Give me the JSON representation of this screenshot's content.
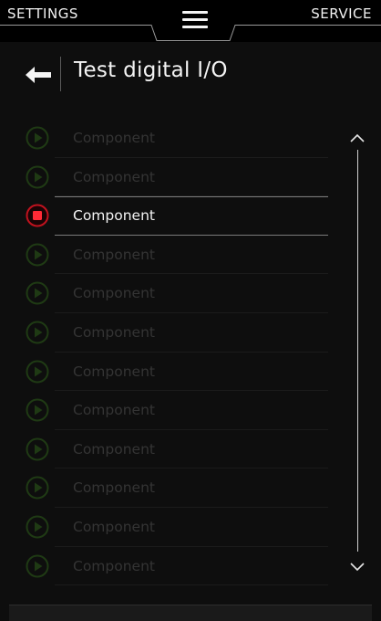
{
  "topbar": {
    "left_tab": "SETTINGS",
    "right_tab": "SERVICE",
    "menu_icon": "hamburger-icon"
  },
  "header": {
    "back_icon": "arrow-left-icon",
    "title": "Test digital I/O"
  },
  "list": {
    "items": [
      {
        "label": "Component",
        "state": "inactive",
        "icon": "play-icon"
      },
      {
        "label": "Component",
        "state": "inactive",
        "icon": "play-icon"
      },
      {
        "label": "Component",
        "state": "active",
        "icon": "stop-icon"
      },
      {
        "label": "Component",
        "state": "inactive",
        "icon": "play-icon"
      },
      {
        "label": "Component",
        "state": "inactive",
        "icon": "play-icon"
      },
      {
        "label": "Component",
        "state": "inactive",
        "icon": "play-icon"
      },
      {
        "label": "Component",
        "state": "inactive",
        "icon": "play-icon"
      },
      {
        "label": "Component",
        "state": "inactive",
        "icon": "play-icon"
      },
      {
        "label": "Component",
        "state": "inactive",
        "icon": "play-icon"
      },
      {
        "label": "Component",
        "state": "inactive",
        "icon": "play-icon"
      },
      {
        "label": "Component",
        "state": "inactive",
        "icon": "play-icon"
      },
      {
        "label": "Component",
        "state": "inactive",
        "icon": "play-icon"
      }
    ]
  },
  "scrollbar": {
    "up_icon": "chevron-up-icon",
    "down_icon": "chevron-down-icon"
  },
  "colors": {
    "background": "#0e0e0e",
    "topbar": "#000000",
    "text_active": "#f3f3f3",
    "text_inactive": "#343434",
    "play_icon": "#1f3a14",
    "stop_ring": "#c0121e",
    "stop_fill": "#ff2a36"
  }
}
